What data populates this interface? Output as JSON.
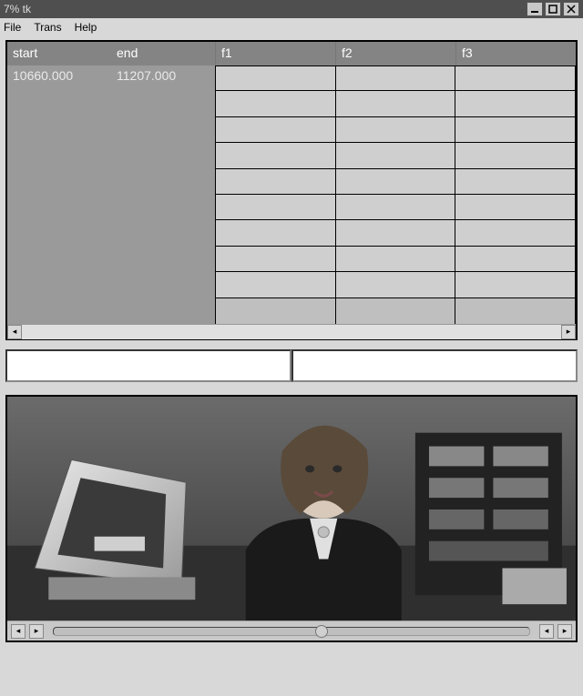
{
  "window": {
    "title": "7% tk",
    "controls": {
      "min": "minimize",
      "max": "maximize",
      "close": "close"
    }
  },
  "menus": {
    "file": "File",
    "trans": "Trans",
    "help": "Help"
  },
  "table": {
    "headers": {
      "start": "start",
      "end": "end",
      "f1": "f1",
      "f2": "f2",
      "f3": "f3"
    },
    "row0": {
      "start": "10660.000",
      "end": "11207.000"
    }
  },
  "textboxes": {
    "left": "",
    "right": ""
  },
  "player": {
    "progress_percent": 55
  }
}
